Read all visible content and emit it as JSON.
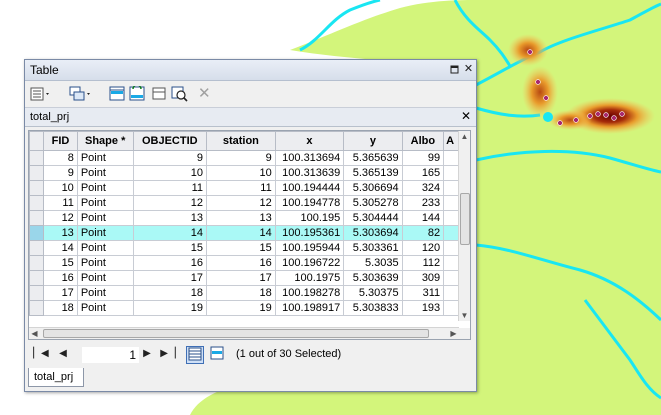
{
  "colors": {
    "map_background": "#ffffff",
    "land": "#d3f57b",
    "river": "#19e6f2",
    "hot_high": "#6b0000",
    "hot_mid": "#e89a2b",
    "hot_low": "#f8c05a",
    "point_color": "#a8286e",
    "selected_row": "#aaf9f6",
    "selected_point": "#19e6f2"
  },
  "window": {
    "title": "Table",
    "pin_icon": "pin-icon",
    "close_icon": "close-icon"
  },
  "toolbar": {
    "icons": [
      "table-options-icon",
      "related-tables-icon",
      "select-by-attributes-icon",
      "switch-selection-icon",
      "clear-selection-icon",
      "zoom-to-selected-icon",
      "delete-selected-icon"
    ]
  },
  "table_tab": {
    "name": "total_prj"
  },
  "grid": {
    "columns": [
      "FID",
      "Shape *",
      "OBJECTID",
      "station",
      "x",
      "y",
      "Albo",
      "A"
    ],
    "rows": [
      {
        "FID": "8",
        "Shape": "Point",
        "OBJECTID": "9",
        "station": "9",
        "x": "100.313694",
        "y": "5.365639",
        "Albo": "99",
        "selected": false
      },
      {
        "FID": "9",
        "Shape": "Point",
        "OBJECTID": "10",
        "station": "10",
        "x": "100.313639",
        "y": "5.365139",
        "Albo": "165",
        "selected": false
      },
      {
        "FID": "10",
        "Shape": "Point",
        "OBJECTID": "11",
        "station": "11",
        "x": "100.194444",
        "y": "5.306694",
        "Albo": "324",
        "selected": false
      },
      {
        "FID": "11",
        "Shape": "Point",
        "OBJECTID": "12",
        "station": "12",
        "x": "100.194778",
        "y": "5.305278",
        "Albo": "233",
        "selected": false
      },
      {
        "FID": "12",
        "Shape": "Point",
        "OBJECTID": "13",
        "station": "13",
        "x": "100.195",
        "y": "5.304444",
        "Albo": "144",
        "selected": false
      },
      {
        "FID": "13",
        "Shape": "Point",
        "OBJECTID": "14",
        "station": "14",
        "x": "100.195361",
        "y": "5.303694",
        "Albo": "82",
        "selected": true
      },
      {
        "FID": "14",
        "Shape": "Point",
        "OBJECTID": "15",
        "station": "15",
        "x": "100.195944",
        "y": "5.303361",
        "Albo": "120",
        "selected": false
      },
      {
        "FID": "15",
        "Shape": "Point",
        "OBJECTID": "16",
        "station": "16",
        "x": "100.196722",
        "y": "5.3035",
        "Albo": "112",
        "selected": false
      },
      {
        "FID": "16",
        "Shape": "Point",
        "OBJECTID": "17",
        "station": "17",
        "x": "100.1975",
        "y": "5.303639",
        "Albo": "309",
        "selected": false
      },
      {
        "FID": "17",
        "Shape": "Point",
        "OBJECTID": "18",
        "station": "18",
        "x": "100.198278",
        "y": "5.30375",
        "Albo": "311",
        "selected": false
      },
      {
        "FID": "18",
        "Shape": "Point",
        "OBJECTID": "19",
        "station": "19",
        "x": "100.198917",
        "y": "5.303833",
        "Albo": "193",
        "selected": false
      }
    ]
  },
  "navigation": {
    "current_record": "1",
    "status": "(1 out of 30 Selected)",
    "first_icon": "first-record-icon",
    "prev_icon": "previous-record-icon",
    "next_icon": "next-record-icon",
    "last_icon": "last-record-icon",
    "show_all_icon": "show-all-records-icon",
    "show_selected_icon": "show-selected-records-icon"
  },
  "bottom_tab": {
    "label": "total_prj"
  }
}
